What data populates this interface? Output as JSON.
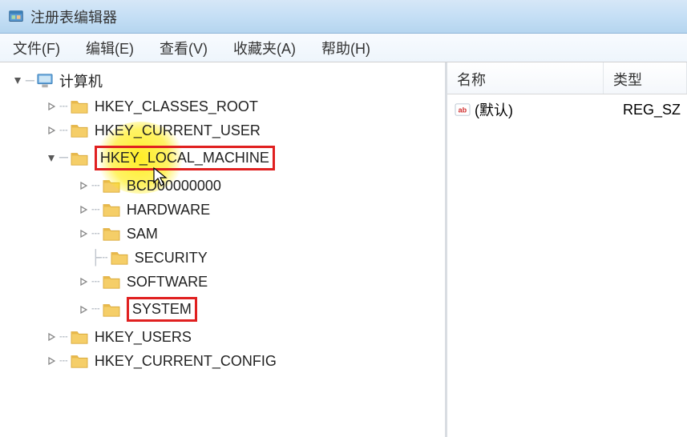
{
  "titlebar": {
    "text": "注册表编辑器"
  },
  "menubar": {
    "file": "文件(F)",
    "edit": "编辑(E)",
    "view": "查看(V)",
    "favorites": "收藏夹(A)",
    "help": "帮助(H)"
  },
  "tree": {
    "root": "计算机",
    "hkcr": "HKEY_CLASSES_ROOT",
    "hkcu": "HKEY_CURRENT_USER",
    "hklm": "HKEY_LOCAL_MACHINE",
    "bcd": "BCD00000000",
    "hardware": "HARDWARE",
    "sam": "SAM",
    "security": "SECURITY",
    "software": "SOFTWARE",
    "system": "SYSTEM",
    "hku": "HKEY_USERS",
    "hkcc": "HKEY_CURRENT_CONFIG"
  },
  "list": {
    "headers": {
      "name": "名称",
      "type": "类型"
    },
    "rows": [
      {
        "name": "(默认)",
        "type": "REG_SZ"
      }
    ]
  }
}
